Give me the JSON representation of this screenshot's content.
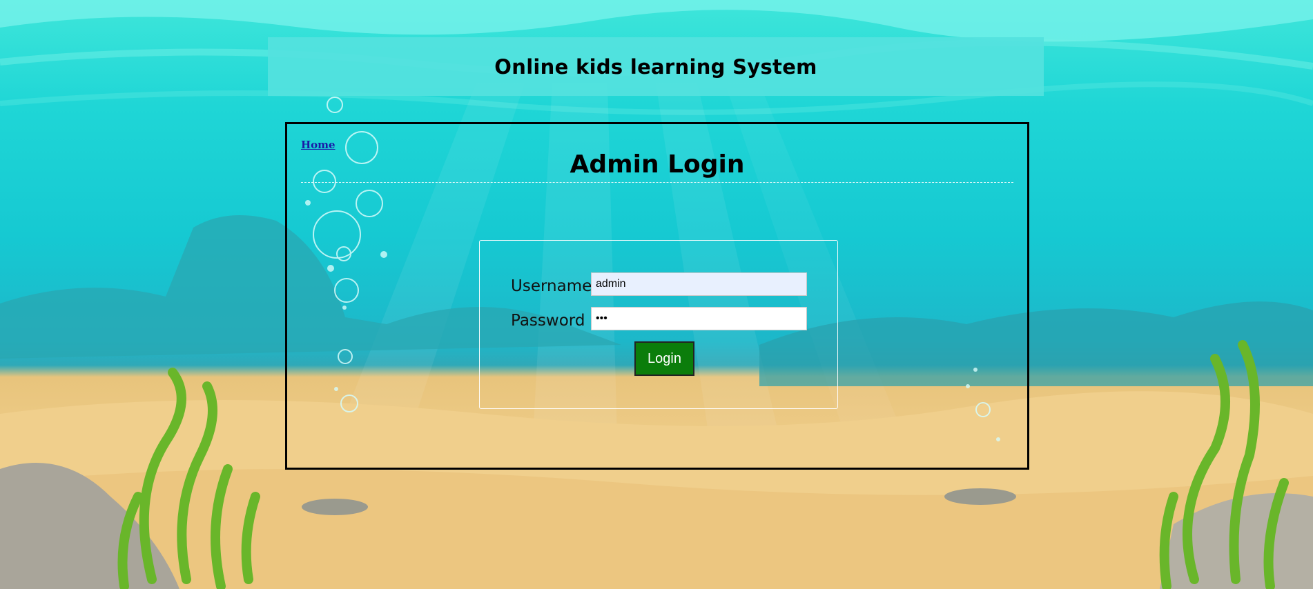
{
  "site": {
    "title": "Online kids learning System"
  },
  "nav": {
    "home_label": "Home"
  },
  "page": {
    "heading": "Admin Login"
  },
  "login_form": {
    "username_label": "Username",
    "username_value": "admin",
    "password_label": "Password",
    "password_value": "•••",
    "submit_label": "Login"
  },
  "colors": {
    "login_button": "#0b7d0b",
    "link": "#1a1aa6",
    "header_bg": "#54e2de"
  }
}
